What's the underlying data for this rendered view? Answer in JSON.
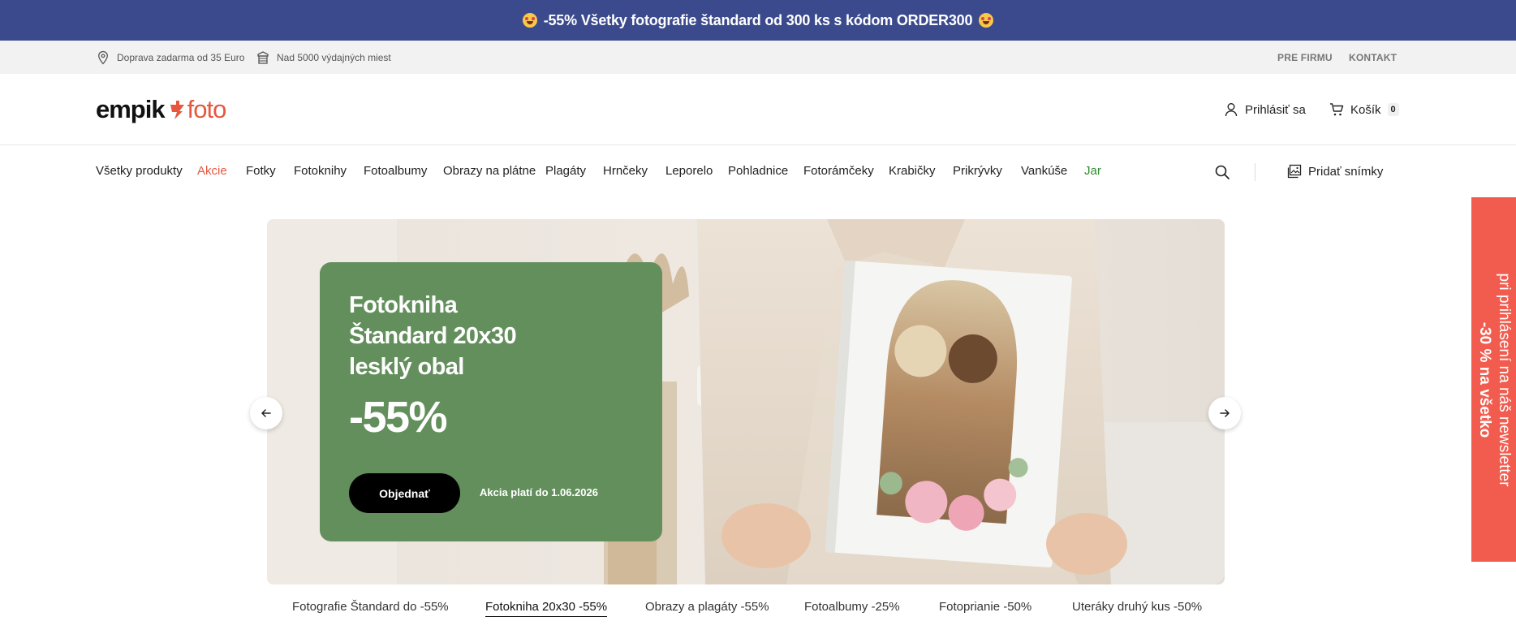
{
  "promo_bar": {
    "text": "-55% Všetky fotografie štandard od 300 ks s kódom ORDER300"
  },
  "info_bar": {
    "shipping": "Doprava zadarma od 35 Euro",
    "pickup": "Nad 5000 výdajných miest",
    "links": [
      "PRE FIRMU",
      "KONTAKT"
    ]
  },
  "header": {
    "logo_left": "empik",
    "logo_right": "foto",
    "login_label": "Prihlásiť sa",
    "cart_label": "Košík",
    "cart_count": "0"
  },
  "nav": {
    "items": [
      "Všetky produkty",
      "Akcie",
      "Fotky",
      "Fotoknihy",
      "Fotoalbumy",
      "Obrazy na plátne",
      "Plagáty",
      "Hrnčeky",
      "Leporelo",
      "Pohladnice",
      "Fotorámčeky",
      "Krabičky",
      "Prikrývky",
      "Vankúše",
      "Jar"
    ],
    "add_photos_label": "Pridať snímky"
  },
  "hero": {
    "title_lines": [
      "Fotokniha",
      "Štandard 20x30",
      "lesklý obal"
    ],
    "discount": "-55%",
    "button_label": "Objednať",
    "valid_text": "Akcia platí do 1.06.2026"
  },
  "side_tab": {
    "line1": "-30 % na všetko",
    "line2": "pri prihlásení na náš newsletter"
  },
  "tabs": {
    "items": [
      "Fotografie Štandard do -55%",
      "Fotokniha 20x30 -55%",
      "Obrazy a plagáty -55%",
      "Fotoalbumy -25%",
      "Fotoprianie -50%",
      "Uteráky druhý kus -50%"
    ],
    "active_index": 1
  },
  "colors": {
    "promo_bar": "#3b4a8c",
    "accent": "#e5573f",
    "card_green": "#638f5c",
    "side_tab": "#f25c4f",
    "nav_green": "#2e8a2e"
  }
}
